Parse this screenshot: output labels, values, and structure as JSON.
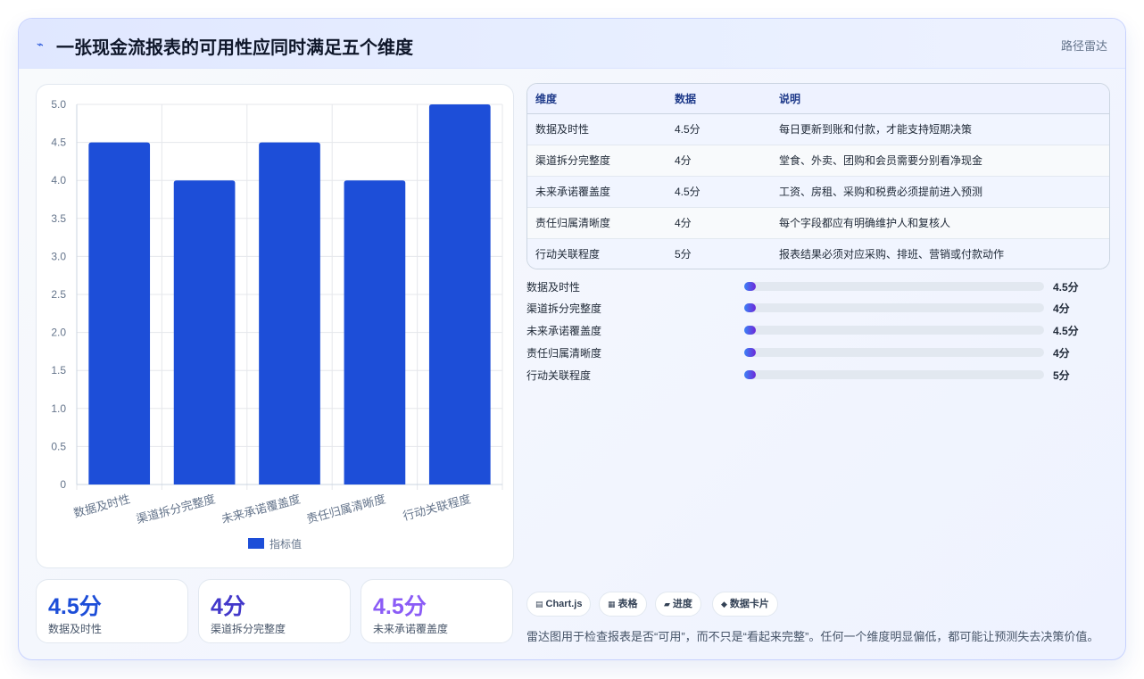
{
  "header": {
    "icon": "zap-icon",
    "title": "一张现金流报表的可用性应同时满足五个维度",
    "route_label": "路径雷达"
  },
  "chart_data": {
    "type": "bar",
    "categories": [
      "数据及时性",
      "渠道拆分完整度",
      "未来承诺覆盖度",
      "责任归属清晰度",
      "行动关联程度"
    ],
    "series": [
      {
        "name": "指标值",
        "values": [
          4.5,
          4,
          4.5,
          4,
          5
        ],
        "color": "#1d4ed8"
      }
    ],
    "yticks": [
      "0",
      "0.5",
      "1.0",
      "1.5",
      "2.0",
      "2.5",
      "3.0",
      "3.5",
      "4.0",
      "4.5",
      "5.0"
    ],
    "ylim": [
      0,
      5
    ],
    "grid": true,
    "legend_position": "bottom"
  },
  "kpis": [
    {
      "value": "4.5分",
      "label": "数据及时性",
      "color": "#1d4ed8"
    },
    {
      "value": "4分",
      "label": "渠道拆分完整度",
      "color": "#4338ca"
    },
    {
      "value": "4.5分",
      "label": "未来承诺覆盖度",
      "color": "#8b5cf6"
    }
  ],
  "table": {
    "headers": [
      "维度",
      "数据",
      "说明"
    ],
    "rows": [
      [
        "数据及时性",
        "4.5分",
        "每日更新到账和付款，才能支持短期决策"
      ],
      [
        "渠道拆分完整度",
        "4分",
        "堂食、外卖、团购和会员需要分别看净现金"
      ],
      [
        "未来承诺覆盖度",
        "4.5分",
        "工资、房租、采购和税费必须提前进入预测"
      ],
      [
        "责任归属清晰度",
        "4分",
        "每个字段都应有明确维护人和复核人"
      ],
      [
        "行动关联程度",
        "5分",
        "报表结果必须对应采购、排班、营销或付款动作"
      ]
    ]
  },
  "progress": [
    {
      "label": "数据及时性",
      "value_text": "4.5分",
      "fraction": 0.03
    },
    {
      "label": "渠道拆分完整度",
      "value_text": "4分",
      "fraction": 0.03
    },
    {
      "label": "未来承诺覆盖度",
      "value_text": "4.5分",
      "fraction": 0.03
    },
    {
      "label": "责任归属清晰度",
      "value_text": "4分",
      "fraction": 0.03
    },
    {
      "label": "行动关联程度",
      "value_text": "5分",
      "fraction": 0.03
    }
  ],
  "chips": [
    {
      "icon": "▤",
      "label": "Chart.js"
    },
    {
      "icon": "▦",
      "label": "表格"
    },
    {
      "icon": "▰",
      "label": "进度"
    },
    {
      "icon": "◆",
      "label": "数据卡片"
    }
  ],
  "footnote": "雷达图用于检查报表是否“可用”，而不只是“看起来完整”。任何一个维度明显偏低，都可能让预测失去决策价值。"
}
